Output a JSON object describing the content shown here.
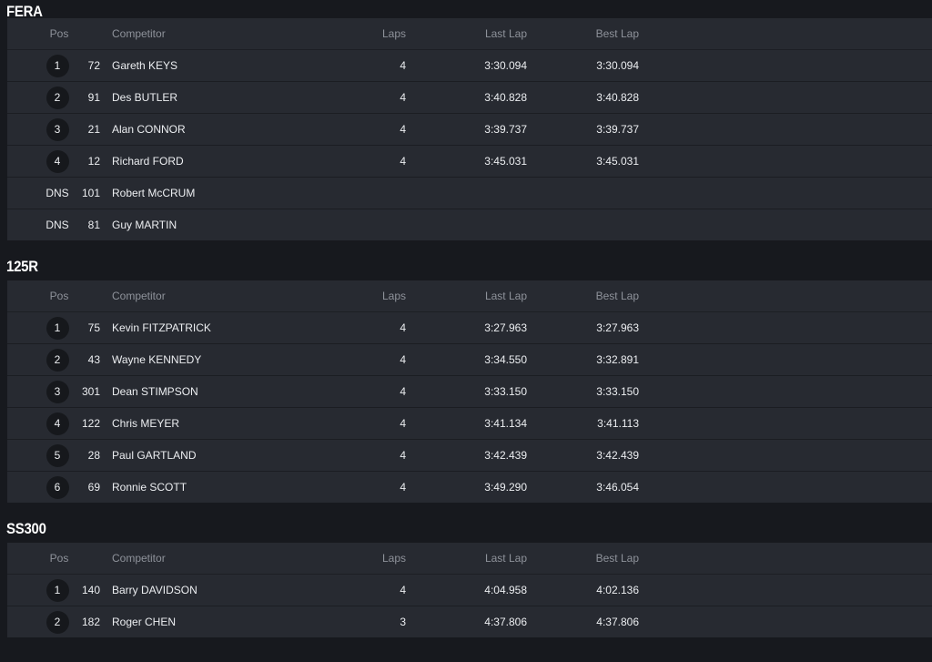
{
  "columns": {
    "pos": "Pos",
    "competitor": "Competitor",
    "laps": "Laps",
    "last_lap": "Last Lap",
    "best_lap": "Best Lap"
  },
  "sections": [
    {
      "title": "FERA",
      "rows": [
        {
          "pos": "1",
          "num": "72",
          "name": "Gareth KEYS",
          "laps": "4",
          "last": "3:30.094",
          "best": "3:30.094"
        },
        {
          "pos": "2",
          "num": "91",
          "name": "Des BUTLER",
          "laps": "4",
          "last": "3:40.828",
          "best": "3:40.828"
        },
        {
          "pos": "3",
          "num": "21",
          "name": "Alan CONNOR",
          "laps": "4",
          "last": "3:39.737",
          "best": "3:39.737"
        },
        {
          "pos": "4",
          "num": "12",
          "name": "Richard FORD",
          "laps": "4",
          "last": "3:45.031",
          "best": "3:45.031"
        },
        {
          "pos": "DNS",
          "num": "101",
          "name": "Robert McCRUM",
          "laps": "",
          "last": "",
          "best": ""
        },
        {
          "pos": "DNS",
          "num": "81",
          "name": "Guy MARTIN",
          "laps": "",
          "last": "",
          "best": ""
        }
      ]
    },
    {
      "title": "125R",
      "rows": [
        {
          "pos": "1",
          "num": "75",
          "name": "Kevin FITZPATRICK",
          "laps": "4",
          "last": "3:27.963",
          "best": "3:27.963"
        },
        {
          "pos": "2",
          "num": "43",
          "name": "Wayne KENNEDY",
          "laps": "4",
          "last": "3:34.550",
          "best": "3:32.891"
        },
        {
          "pos": "3",
          "num": "301",
          "name": "Dean STIMPSON",
          "laps": "4",
          "last": "3:33.150",
          "best": "3:33.150"
        },
        {
          "pos": "4",
          "num": "122",
          "name": "Chris MEYER",
          "laps": "4",
          "last": "3:41.134",
          "best": "3:41.113"
        },
        {
          "pos": "5",
          "num": "28",
          "name": "Paul GARTLAND",
          "laps": "4",
          "last": "3:42.439",
          "best": "3:42.439"
        },
        {
          "pos": "6",
          "num": "69",
          "name": "Ronnie SCOTT",
          "laps": "4",
          "last": "3:49.290",
          "best": "3:46.054"
        }
      ]
    },
    {
      "title": "SS300",
      "rows": [
        {
          "pos": "1",
          "num": "140",
          "name": "Barry DAVIDSON",
          "laps": "4",
          "last": "4:04.958",
          "best": "4:02.136"
        },
        {
          "pos": "2",
          "num": "182",
          "name": "Roger CHEN",
          "laps": "3",
          "last": "4:37.806",
          "best": "4:37.806"
        }
      ]
    }
  ]
}
